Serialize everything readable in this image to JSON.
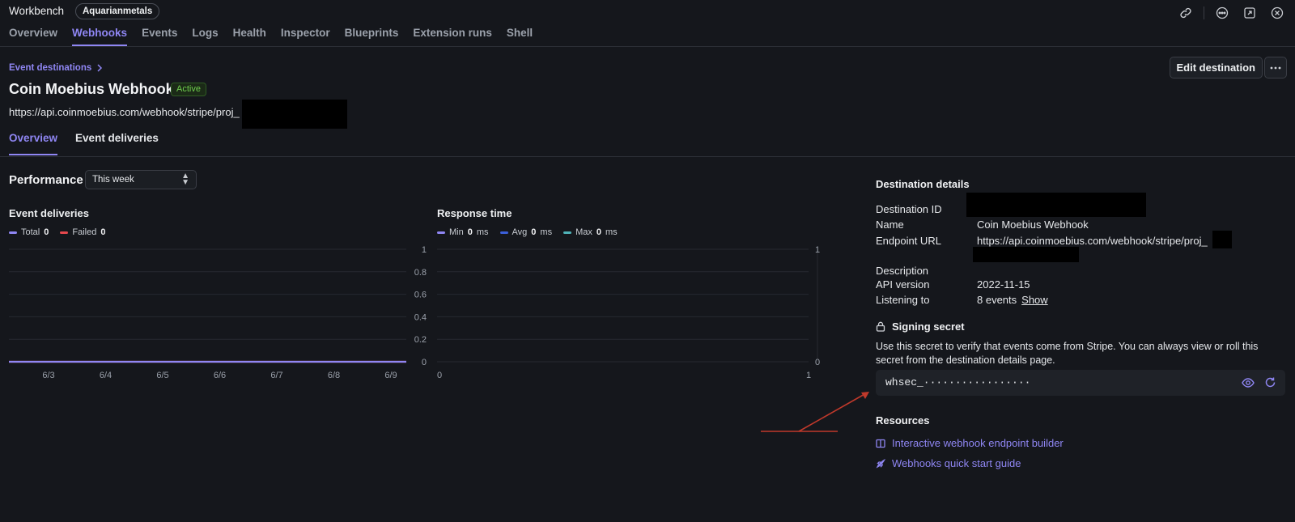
{
  "app": {
    "title": "Workbench",
    "account": "Aquarianmetals"
  },
  "nav": {
    "items": [
      "Overview",
      "Webhooks",
      "Events",
      "Logs",
      "Health",
      "Inspector",
      "Blueprints",
      "Extension runs",
      "Shell"
    ],
    "active": "Webhooks"
  },
  "top_icons": [
    "link-icon",
    "more-horizontal-icon",
    "expand-icon",
    "close-icon"
  ],
  "header": {
    "breadcrumb": "Event destinations",
    "title": "Coin Moebius Webhook",
    "status": "Active",
    "url": "https://api.coinmoebius.com/webhook/stripe/proj_",
    "edit_label": "Edit destination"
  },
  "tabs": {
    "items": [
      "Overview",
      "Event deliveries"
    ],
    "active": "Overview"
  },
  "performance": {
    "title": "Performance",
    "range": "This week"
  },
  "colors": {
    "accent": "#8f86f3",
    "failed": "#e5484d",
    "avg": "#3b5fd9",
    "max": "#4fb3b8",
    "active_badge": "#6fce4e"
  },
  "chart_data": [
    {
      "type": "line",
      "title": "Event deliveries",
      "x": [
        "6/3",
        "6/4",
        "6/5",
        "6/6",
        "6/7",
        "6/8",
        "6/9"
      ],
      "series": [
        {
          "name": "Total",
          "total": "0",
          "values": [
            0,
            0,
            0,
            0,
            0,
            0,
            0
          ]
        },
        {
          "name": "Failed",
          "total": "0",
          "values": [
            0,
            0,
            0,
            0,
            0,
            0,
            0
          ]
        }
      ],
      "ylim": [
        0,
        1
      ],
      "yticks": [
        "1",
        "0.8",
        "0.6",
        "0.4",
        "0.2",
        "0"
      ],
      "grid": true,
      "legend": "top-left"
    },
    {
      "type": "line",
      "title": "Response time",
      "series": [
        {
          "name": "Min",
          "value": "0",
          "unit": "ms",
          "values": []
        },
        {
          "name": "Avg",
          "value": "0",
          "unit": "ms",
          "values": []
        },
        {
          "name": "Max",
          "value": "0",
          "unit": "ms",
          "values": []
        }
      ],
      "xticks": [
        "0",
        "1"
      ],
      "yticks": [
        "1",
        "0"
      ],
      "ylim": [
        0,
        1
      ],
      "grid": true,
      "legend": "top-left"
    }
  ],
  "details": {
    "title": "Destination details",
    "rows": [
      {
        "label": "Destination ID",
        "value": ""
      },
      {
        "label": "Name",
        "value": "Coin Moebius Webhook"
      },
      {
        "label": "Endpoint URL",
        "value": "https://api.coinmoebius.com/webhook/stripe/proj_"
      },
      {
        "label": "Description",
        "value": ""
      },
      {
        "label": "API version",
        "value": "2022-11-15"
      },
      {
        "label": "Listening to",
        "value": "8 events",
        "link": "Show"
      }
    ]
  },
  "signing_secret": {
    "title": "Signing secret",
    "description_line1": "Use this secret to verify that events come from Stripe. You can always view or roll this",
    "description_line2": "secret from the destination details page.",
    "value": "whsec_·················"
  },
  "resources": {
    "title": "Resources",
    "links": [
      "Interactive webhook endpoint builder",
      "Webhooks quick start guide"
    ]
  }
}
